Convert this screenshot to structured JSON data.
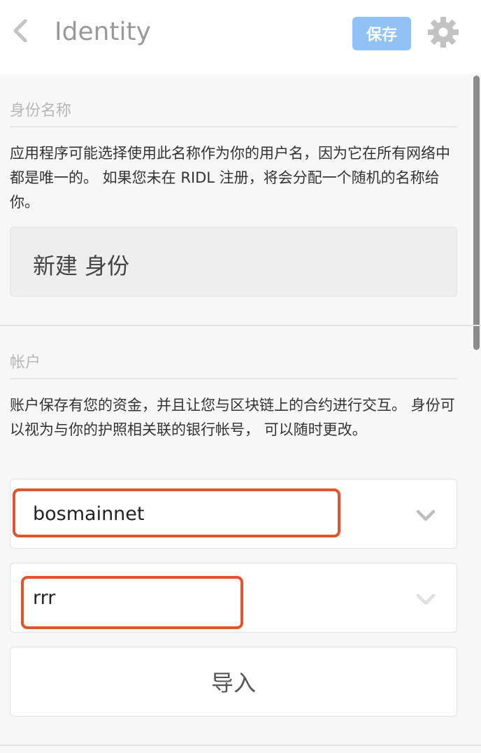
{
  "header": {
    "back_icon": "chevron-left-icon",
    "title": "Identity",
    "save_label": "保存",
    "settings_icon": "gear-icon"
  },
  "identity_section": {
    "label": "身份名称",
    "description": "应用程序可能选择使用此名称作为你的用户名，因为它在所有网络中都是唯一的。 如果您未在 RIDL 注册，将会分配一个随机的名称给你。",
    "name_value": "新建 身份"
  },
  "account_section": {
    "label": "帐户",
    "description": "账户保存有您的资金，并且让您与区块链上的合约进行交互。 身份可以视为与你的护照相关联的银行帐号， 可以随时更改。",
    "network_select": {
      "value": "bosmainnet",
      "icon": "chevron-down-icon"
    },
    "account_select": {
      "value": "rrr",
      "icon": "chevron-down-icon"
    },
    "import_label": "导入"
  },
  "colors": {
    "accent": "#90c2f6",
    "highlight": "#e0542e"
  }
}
